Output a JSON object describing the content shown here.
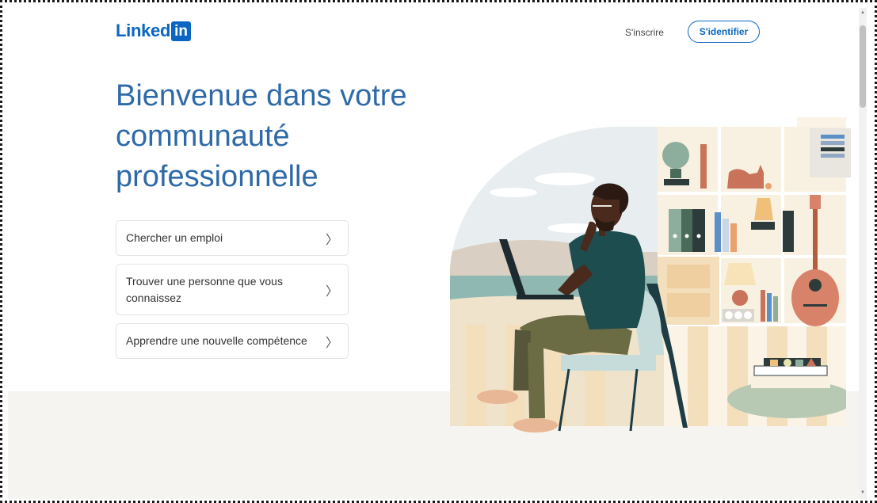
{
  "header": {
    "logo_word": "Linked",
    "logo_box": "in",
    "join_label": "S'inscrire",
    "signin_label": "S'identifier"
  },
  "hero": {
    "title_line1": "Bienvenue dans votre",
    "title_line2": "communauté",
    "title_line3": "professionnelle"
  },
  "options": [
    {
      "label": "Chercher un emploi",
      "chevron": "〉"
    },
    {
      "label_line1": "Trouver une personne que vous",
      "label_line2": "connaissez",
      "chevron": "〉"
    },
    {
      "label": "Apprendre une nouvelle compétence",
      "chevron": "〉"
    }
  ],
  "scrollbar": {
    "up": "▲",
    "down": "▼"
  },
  "colors": {
    "brand": "#0a66c2",
    "title": "#2f6aa8",
    "band": "#f6f4f1"
  }
}
